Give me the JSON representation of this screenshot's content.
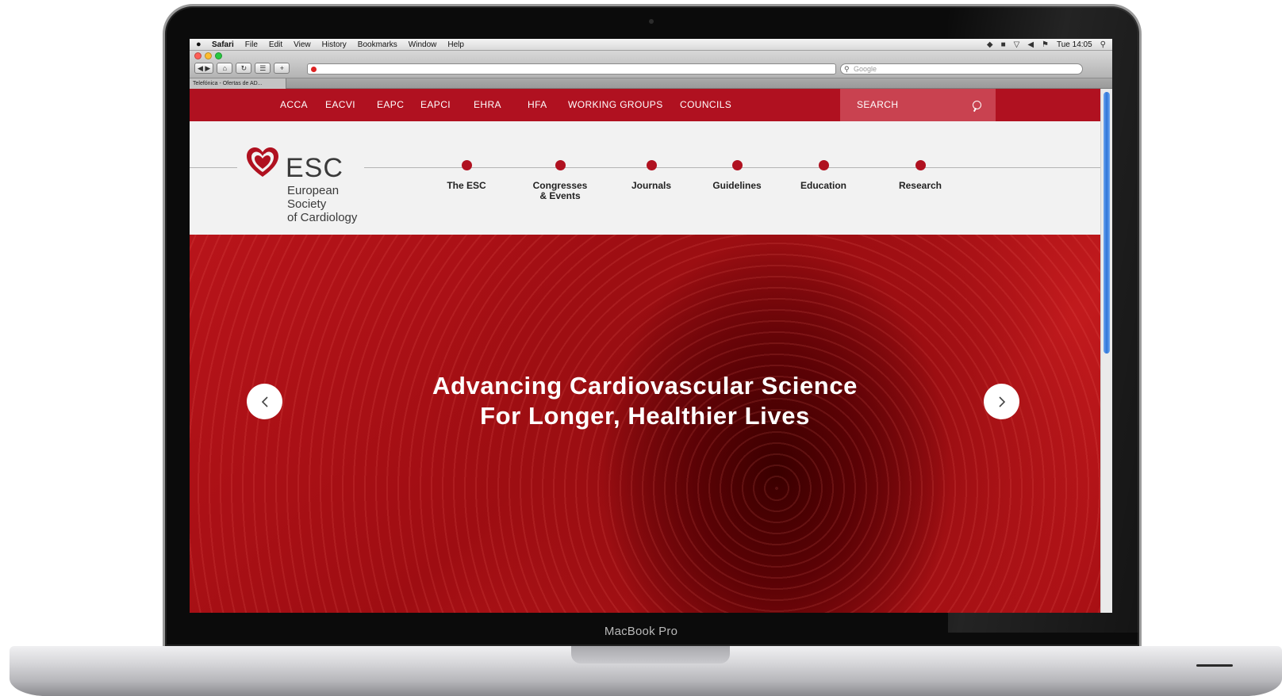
{
  "device": {
    "brand": "MacBook Pro"
  },
  "os_menubar": {
    "apple": "",
    "items": [
      "Safari",
      "File",
      "Edit",
      "View",
      "History",
      "Bookmarks",
      "Window",
      "Help"
    ],
    "clock": "Tue 14:05"
  },
  "browser": {
    "search_placeholder": "Google",
    "tab_title": "Telefónica - Ofertas de AD...",
    "traffic_colors": [
      "#ff5f57",
      "#febc2e",
      "#28c840"
    ]
  },
  "site": {
    "colors": {
      "brand_red": "#b01120",
      "search_bg": "#c94250"
    },
    "topnav": [
      "ACCA",
      "EACVI",
      "EAPC",
      "EAPCI",
      "EHRA",
      "HFA",
      "WORKING GROUPS",
      "COUNCILS"
    ],
    "search_placeholder": "SEARCH",
    "logo": {
      "acronym": "ESC",
      "line1": "European Society",
      "line2": "of Cardiology"
    },
    "mainnav": [
      "The ESC",
      "Congresses\n& Events",
      "Journals",
      "Guidelines",
      "Education",
      "Research"
    ],
    "hero": {
      "line1": "Advancing Cardiovascular Science",
      "line2": "For Longer, Healthier Lives"
    }
  }
}
